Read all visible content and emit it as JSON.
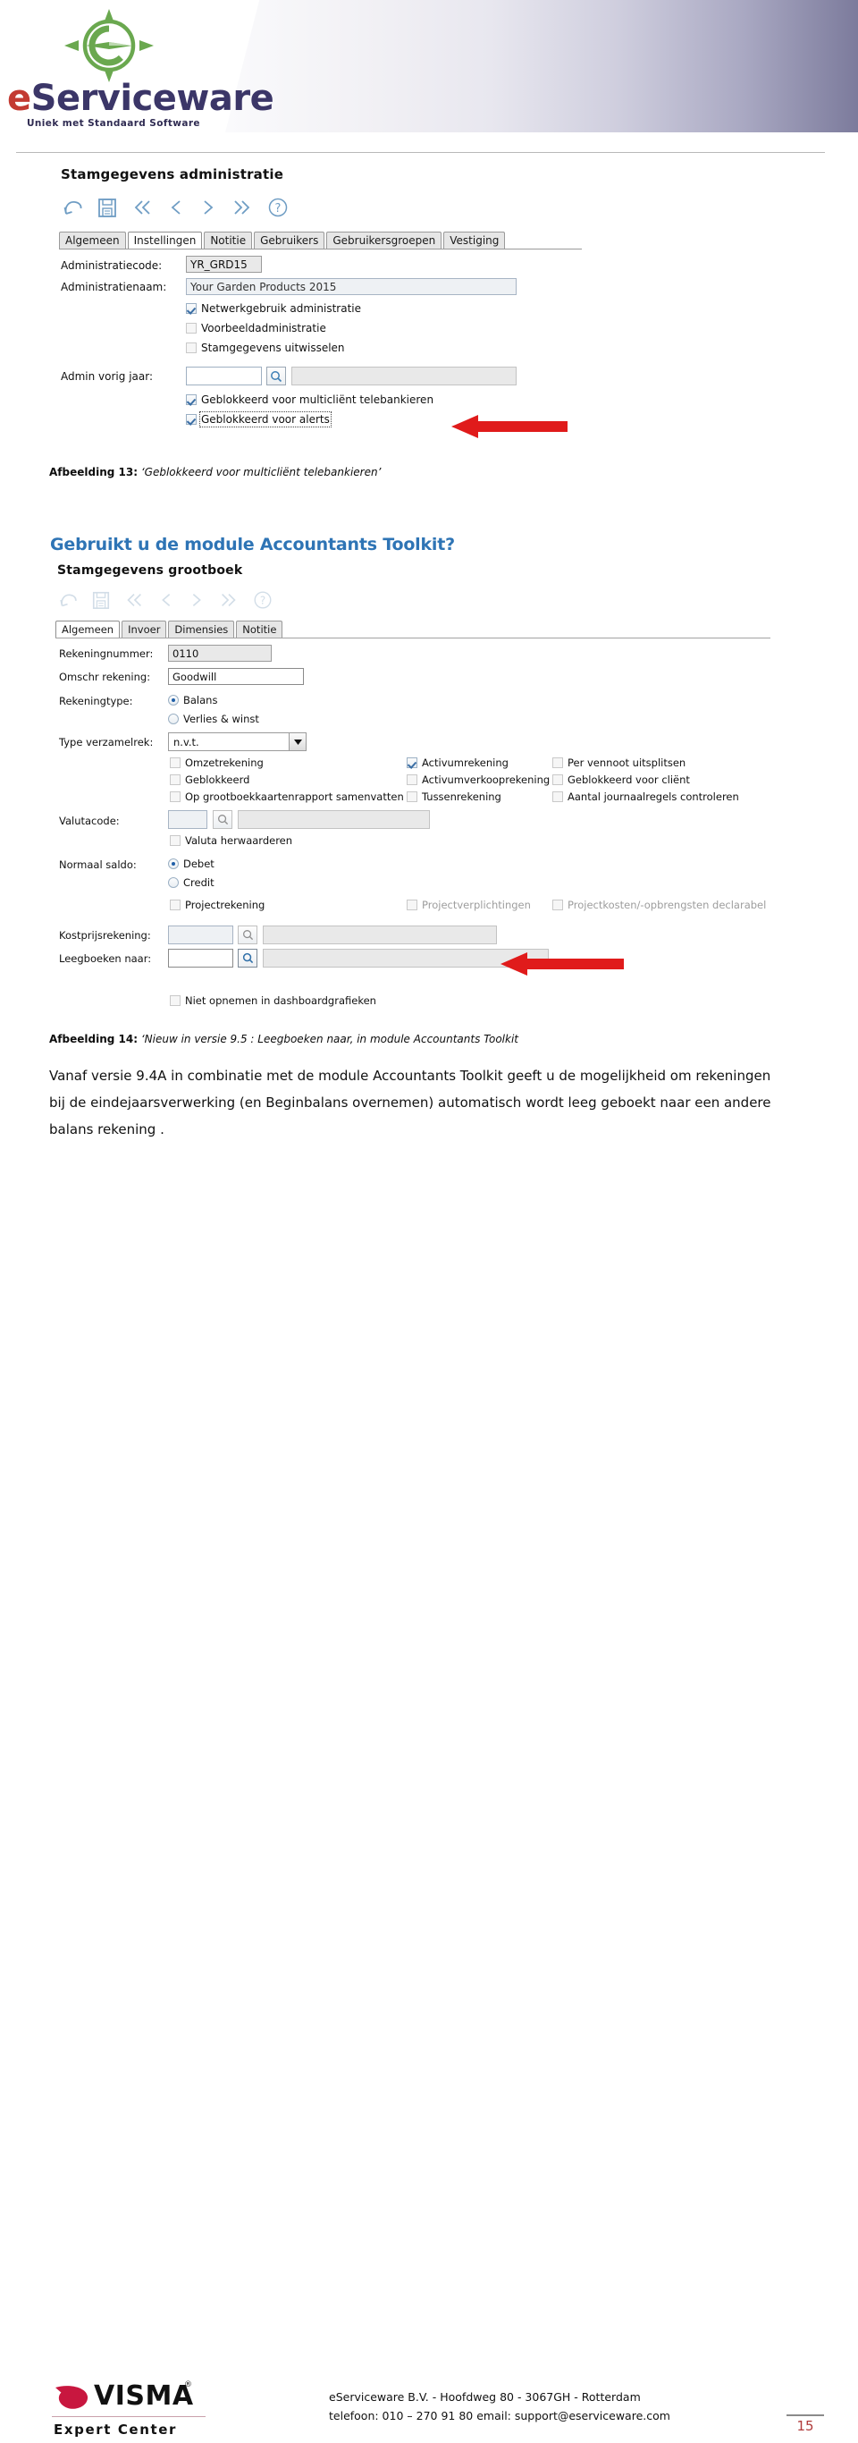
{
  "brand": {
    "logo_name": "eServiceware",
    "logo_name_first": "e",
    "logo_name_rest": "Serviceware",
    "tagline": "Uniek met Standaard Software",
    "accent_green": "#6aa84f",
    "accent_purple": "#3b3668",
    "accent_red": "#c33a32"
  },
  "figure13": {
    "window_title": "Stamgegevens administratie",
    "toolbar": {
      "undo": "undo-arrow",
      "save": "save-diskette",
      "first": "first-record",
      "prev": "previous-record",
      "next": "next-record",
      "last": "last-record",
      "help": "help-question"
    },
    "tabs": [
      {
        "label": "Algemeen",
        "active": false
      },
      {
        "label": "Instellingen",
        "active": true
      },
      {
        "label": "Notitie",
        "active": false
      },
      {
        "label": "Gebruikers",
        "active": false
      },
      {
        "label": "Gebruikersgroepen",
        "active": false
      },
      {
        "label": "Vestiging",
        "active": false
      }
    ],
    "fields": {
      "administratiecode_label": "Administratiecode:",
      "administratiecode_value": "YR_GRD15",
      "administratienaam_label": "Administratienaam:",
      "administratienaam_value": "Your Garden Products 2015",
      "admin_vorig_jaar_label": "Admin vorig jaar:",
      "admin_vorig_jaar_code": "",
      "admin_vorig_jaar_name": ""
    },
    "checkboxes": [
      {
        "label": "Netwerkgebruik administratie",
        "checked": true
      },
      {
        "label": "Voorbeeldadministratie",
        "checked": false
      },
      {
        "label": "Stamgegevens uitwisselen",
        "checked": false
      },
      {
        "label": "Geblokkeerd voor multicliënt telebankieren",
        "checked": true
      },
      {
        "label": "Geblokkeerd voor alerts",
        "checked": true
      }
    ],
    "annotation_arrow_color": "#e01b1b",
    "caption_prefix": "Afbeelding 13:",
    "caption_text": "‘Geblokkeerd voor multicliënt telebankieren’"
  },
  "heading": "Gebruikt u de module Accountants Toolkit?",
  "figure14": {
    "window_title": "Stamgegevens grootboek",
    "tabs": [
      {
        "label": "Algemeen",
        "active": true
      },
      {
        "label": "Invoer",
        "active": false
      },
      {
        "label": "Dimensies",
        "active": false
      },
      {
        "label": "Notitie",
        "active": false
      }
    ],
    "fields": {
      "rekeningnummer_label": "Rekeningnummer:",
      "rekeningnummer_value": "0110",
      "omschr_label": "Omschr rekening:",
      "omschr_value": "Goodwill",
      "rekeningtype_label": "Rekeningtype:",
      "type_verzamelrek_label": "Type verzamelrek:",
      "type_verzamelrek_value": "n.v.t.",
      "valutacode_label": "Valutacode:",
      "valutacode_code": "",
      "valutacode_name": "",
      "normaal_saldo_label": "Normaal saldo:",
      "kostprijsrekening_label": "Kostprijsrekening:",
      "kostprijsrekening_code": "",
      "kostprijsrekening_name": "",
      "leegboeken_label": "Leegboeken naar:",
      "leegboeken_code": "",
      "leegboeken_name": ""
    },
    "radios": {
      "rekeningtype": [
        {
          "label": "Balans",
          "selected": true
        },
        {
          "label": "Verlies & winst",
          "selected": false
        }
      ],
      "normaal_saldo": [
        {
          "label": "Debet",
          "selected": true
        },
        {
          "label": "Credit",
          "selected": false
        }
      ]
    },
    "checkbox_col1": [
      {
        "label": "Omzetrekening",
        "checked": false
      },
      {
        "label": "Geblokkeerd",
        "checked": false
      },
      {
        "label": "Op grootboekkaartenrapport samenvatten",
        "checked": false
      }
    ],
    "checkbox_col2": [
      {
        "label": "Activumrekening",
        "checked": true
      },
      {
        "label": "Activumverkooprekening",
        "checked": false
      },
      {
        "label": "Tussenrekening",
        "checked": false
      }
    ],
    "checkbox_col3": [
      {
        "label": "Per vennoot uitsplitsen",
        "checked": false
      },
      {
        "label": "Geblokkeerd voor cliënt",
        "checked": false
      },
      {
        "label": "Aantal journaalregels controleren",
        "checked": false
      }
    ],
    "valuta_herwaarderen": {
      "label": "Valuta herwaarderen",
      "checked": false
    },
    "project_row": [
      {
        "label": "Projectrekening",
        "checked": false,
        "faded": false
      },
      {
        "label": "Projectverplichtingen",
        "checked": false,
        "faded": true
      },
      {
        "label": "Projectkosten/-opbrengsten declarabel",
        "checked": false,
        "faded": true
      }
    ],
    "dashboard_checkbox": {
      "label": "Niet opnemen in dashboardgrafieken",
      "checked": false
    },
    "caption_prefix": "Afbeelding 14:",
    "caption_text": "‘Nieuw in versie 9.5 : Leegboeken naar, in module Accountants Toolkit"
  },
  "paragraph": "Vanaf versie 9.4A in combinatie met de module Accountants Toolkit geeft u de mogelijkheid om rekeningen bij de eindejaarsverwerking (en Beginbalans overnemen) automatisch wordt leeg geboekt naar een andere balans rekening .",
  "footer": {
    "visma_name": "VISMA",
    "visma_reg": "®",
    "visma_sub": "Expert Center",
    "line1": "eServiceware B.V. - Hoofdweg 80 - 3067GH - Rotterdam",
    "line2": "telefoon: 010 – 270 91 80   email: support@eserviceware.com",
    "page_number": "15"
  }
}
